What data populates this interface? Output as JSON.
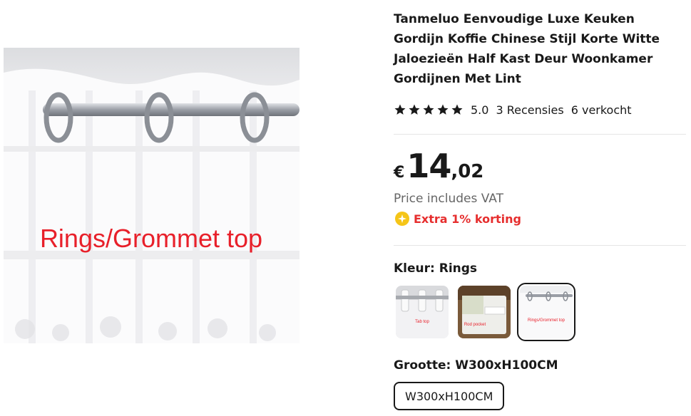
{
  "product": {
    "title": "Tanmeluo Eenvoudige Luxe Keuken Gordijn Koffie Chinese Stijl Korte Witte Jaloezieën Half Kast Deur Woonkamer Gordijnen Met Lint",
    "image_caption": "Rings/Grommet top"
  },
  "rating": {
    "stars": 5,
    "score": "5.0",
    "reviews": "3 Recensies",
    "sold": "6 verkocht"
  },
  "price": {
    "currency": "€",
    "integer": "14",
    "decimal": ",02",
    "vat_note": "Price includes VAT",
    "discount": "Extra 1% korting"
  },
  "color": {
    "label": "Kleur: Rings",
    "swatches": [
      {
        "caption": "Tab top",
        "selected": false
      },
      {
        "caption": "Rod pocket",
        "selected": false
      },
      {
        "caption": "Rings/Grommet top",
        "selected": true
      }
    ]
  },
  "size": {
    "label": "Grootte: W300xH100CM",
    "option": "W300xH100CM"
  },
  "colors": {
    "text": "#191919",
    "muted": "#666666",
    "discount": "#e62e2e",
    "coin": "#f5c518",
    "caption_red": "#e8202a"
  }
}
